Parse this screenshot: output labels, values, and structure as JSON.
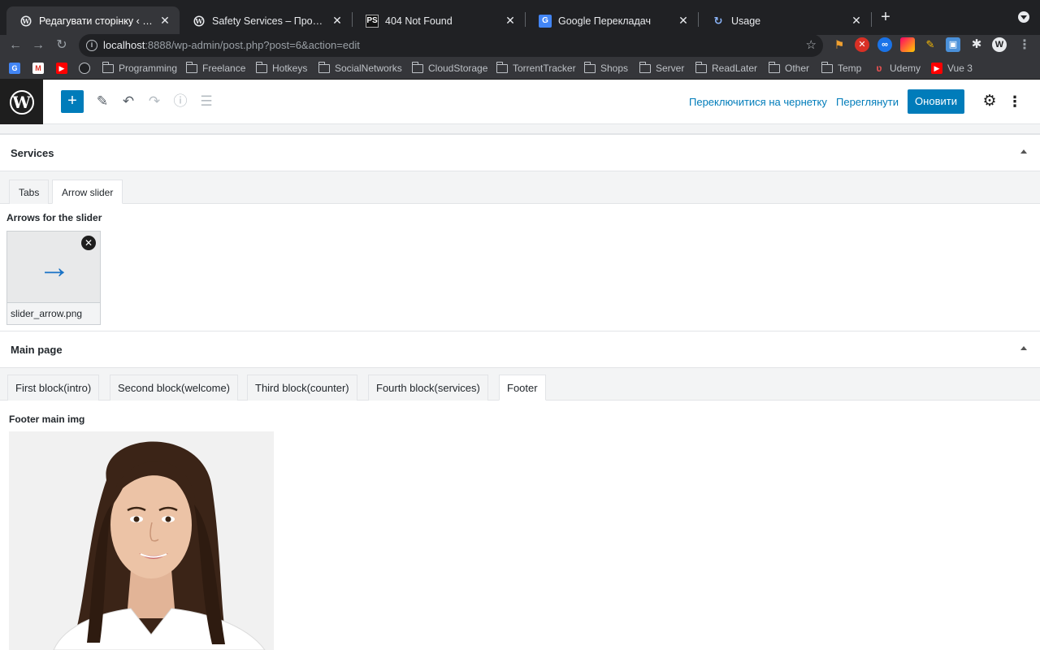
{
  "browser": {
    "tabs": [
      {
        "title": "Редагувати сторінку ‹ Safety",
        "favicon": "wordpress-icon",
        "active": true
      },
      {
        "title": "Safety Services – Просто ще о",
        "favicon": "wordpress-icon",
        "active": false
      },
      {
        "title": "404 Not Found",
        "favicon": "phpstorm-icon",
        "active": false
      },
      {
        "title": "Google Перекладач",
        "favicon": "google-translate-icon",
        "active": false
      },
      {
        "title": "Usage",
        "favicon": "loop-icon",
        "active": false
      }
    ],
    "address": {
      "host": "localhost",
      "path": ":8888/wp-admin/post.php?post=6&action=edit"
    },
    "bookmarks": [
      {
        "label": "",
        "type": "google-translate"
      },
      {
        "label": "",
        "type": "gmail"
      },
      {
        "label": "",
        "type": "youtube"
      },
      {
        "label": "",
        "type": "github"
      },
      {
        "label": "Programming",
        "type": "folder"
      },
      {
        "label": "Freelance",
        "type": "folder"
      },
      {
        "label": "Hotkeys",
        "type": "folder"
      },
      {
        "label": "SocialNetworks",
        "type": "folder"
      },
      {
        "label": "CloudStorage",
        "type": "folder"
      },
      {
        "label": "TorrentTracker",
        "type": "folder"
      },
      {
        "label": "Shops",
        "type": "folder"
      },
      {
        "label": "Server",
        "type": "folder"
      },
      {
        "label": "ReadLater",
        "type": "folder"
      },
      {
        "label": "Other",
        "type": "folder"
      },
      {
        "label": "Temp",
        "type": "folder"
      },
      {
        "label": "Udemy",
        "type": "udemy"
      },
      {
        "label": "Vue 3",
        "type": "youtube"
      }
    ]
  },
  "editor": {
    "switch_to_draft": "Переключитися на чернетку",
    "preview": "Переглянути",
    "update": "Оновити"
  },
  "services_panel": {
    "title": "Services",
    "tabs": [
      "Tabs",
      "Arrow slider"
    ],
    "active_tab": 1,
    "field_label": "Arrows for the slider",
    "file_name": "slider_arrow.png"
  },
  "main_page_panel": {
    "title": "Main page",
    "tabs": [
      "First block(intro)",
      "Second block(welcome)",
      "Third block(counter)",
      "Fourth block(services)",
      "Footer"
    ],
    "active_tab": 4,
    "field_label": "Footer main img"
  },
  "colors": {
    "wp_blue": "#007cba",
    "chrome_dark": "#202124",
    "chrome_toolbar": "#35363a"
  }
}
